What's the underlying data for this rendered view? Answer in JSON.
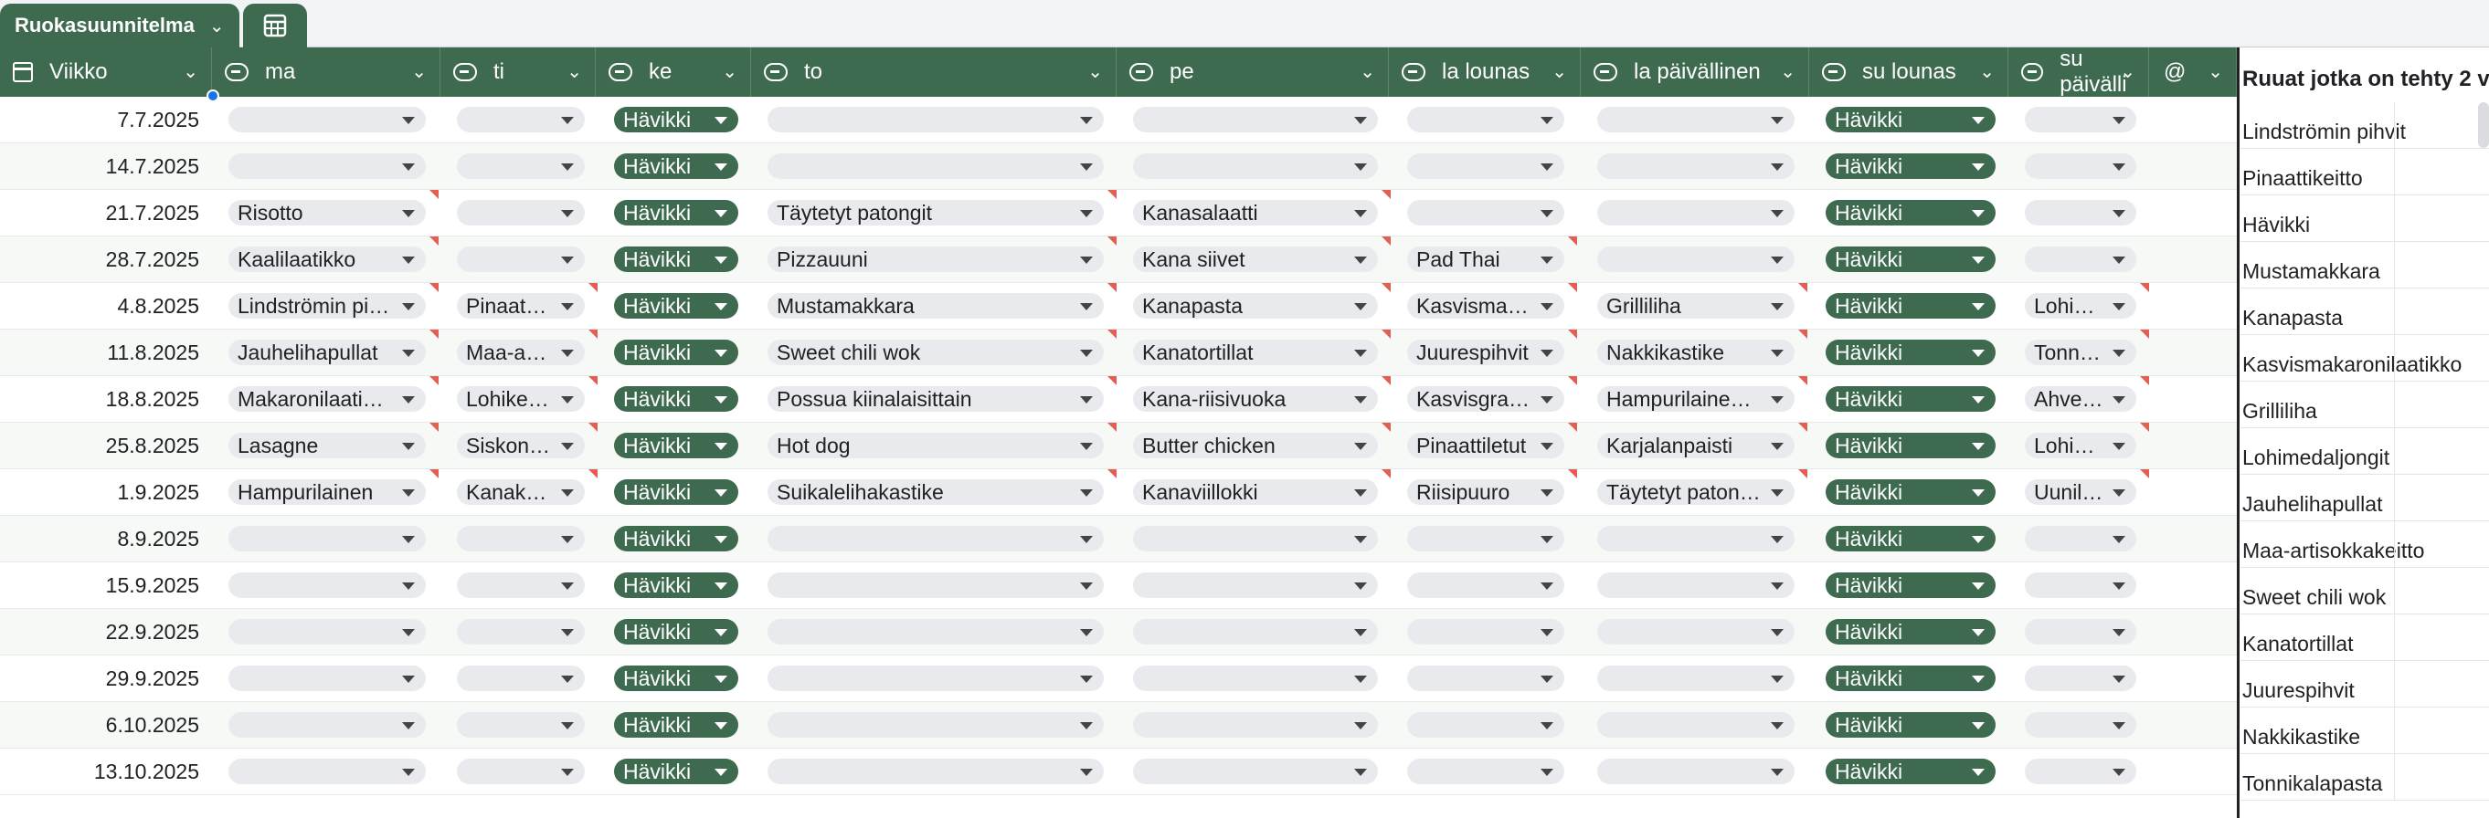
{
  "tabs": {
    "sheet_name": "Ruokasuunnitelma",
    "caret": "⌄",
    "sheet_icon": "table-grid-icon"
  },
  "columns": [
    {
      "key": "viikko",
      "label": "Viikko"
    },
    {
      "key": "ma",
      "label": "ma"
    },
    {
      "key": "ti",
      "label": "ti"
    },
    {
      "key": "ke",
      "label": "ke"
    },
    {
      "key": "to",
      "label": "to"
    },
    {
      "key": "pe",
      "label": "pe"
    },
    {
      "key": "la_lounas",
      "label": "la lounas"
    },
    {
      "key": "la_paivallinen",
      "label": "la päivällinen"
    },
    {
      "key": "su_lounas",
      "label": "su lounas"
    },
    {
      "key": "su_paivallinen",
      "label": "su päivälli"
    },
    {
      "key": "at",
      "label": "@"
    }
  ],
  "rows": [
    {
      "date": "7.7.2025",
      "ma": "",
      "ti": "",
      "ke": "Hävikki",
      "to": "",
      "pe": "",
      "la_lounas": "",
      "la_paivallinen": "",
      "su_lounas": "Hävikki",
      "su_paivallinen": ""
    },
    {
      "date": "14.7.2025",
      "ma": "",
      "ti": "",
      "ke": "Hävikki",
      "to": "",
      "pe": "",
      "la_lounas": "",
      "la_paivallinen": "",
      "su_lounas": "Hävikki",
      "su_paivallinen": ""
    },
    {
      "date": "21.7.2025",
      "ma": "Risotto",
      "ti": "",
      "ke": "Hävikki",
      "to": "Täytetyt patongit",
      "pe": "Kanasalaatti",
      "la_lounas": "",
      "la_paivallinen": "",
      "su_lounas": "Hävikki",
      "su_paivallinen": ""
    },
    {
      "date": "28.7.2025",
      "ma": "Kaalilaatikko",
      "ti": "",
      "ke": "Hävikki",
      "to": "Pizzauuni",
      "pe": "Kana siivet",
      "la_lounas": "Pad Thai",
      "la_paivallinen": "",
      "su_lounas": "Hävikki",
      "su_paivallinen": ""
    },
    {
      "date": "4.8.2025",
      "ma": "Lindströmin pihvit",
      "ti": "Pinaattikeitto",
      "ke": "Hävikki",
      "to": "Mustamakkara",
      "pe": "Kanapasta",
      "la_lounas": "Kasvismakaronilaatikko",
      "la_paivallinen": "Grilliliha",
      "su_lounas": "Hävikki",
      "su_paivallinen": "Lohimedaljongit"
    },
    {
      "date": "11.8.2025",
      "ma": "Jauhelihapullat",
      "ti": "Maa-artisokkakeitto",
      "ke": "Hävikki",
      "to": "Sweet chili wok",
      "pe": "Kanatortillat",
      "la_lounas": "Juurespihvit",
      "la_paivallinen": "Nakkikastike",
      "su_lounas": "Hävikki",
      "su_paivallinen": "Tonnikalapasta"
    },
    {
      "date": "18.8.2025",
      "ma": "Makaronilaatikko",
      "ti": "Lohikeitto",
      "ke": "Hävikki",
      "to": "Possua kiinalaisittain",
      "pe": "Kana-riisivuoka",
      "la_lounas": "Kasvisgratini",
      "la_paivallinen": "Hampurilainen ateria",
      "su_lounas": "Hävikki",
      "su_paivallinen": "Ahvenfilee"
    },
    {
      "date": "25.8.2025",
      "ma": "Lasagne",
      "ti": "Siskonmakkarakeitto",
      "ke": "Hävikki",
      "to": "Hot dog",
      "pe": "Butter chicken",
      "la_lounas": "Pinaattiletut",
      "la_paivallinen": "Karjalanpaisti",
      "su_lounas": "Hävikki",
      "su_paivallinen": "Lohikiusaus"
    },
    {
      "date": "1.9.2025",
      "ma": "Hampurilainen",
      "ti": "Kanakeitto",
      "ke": "Hävikki",
      "to": "Suikalelihakastike",
      "pe": "Kanaviillokki",
      "la_lounas": "Riisipuuro",
      "la_paivallinen": "Täytetyt patongit",
      "su_lounas": "Hävikki",
      "su_paivallinen": "Uunilohi"
    },
    {
      "date": "8.9.2025",
      "ma": "",
      "ti": "",
      "ke": "Hävikki",
      "to": "",
      "pe": "",
      "la_lounas": "",
      "la_paivallinen": "",
      "su_lounas": "Hävikki",
      "su_paivallinen": ""
    },
    {
      "date": "15.9.2025",
      "ma": "",
      "ti": "",
      "ke": "Hävikki",
      "to": "",
      "pe": "",
      "la_lounas": "",
      "la_paivallinen": "",
      "su_lounas": "Hävikki",
      "su_paivallinen": ""
    },
    {
      "date": "22.9.2025",
      "ma": "",
      "ti": "",
      "ke": "Hävikki",
      "to": "",
      "pe": "",
      "la_lounas": "",
      "la_paivallinen": "",
      "su_lounas": "Hävikki",
      "su_paivallinen": ""
    },
    {
      "date": "29.9.2025",
      "ma": "",
      "ti": "",
      "ke": "Hävikki",
      "to": "",
      "pe": "",
      "la_lounas": "",
      "la_paivallinen": "",
      "su_lounas": "Hävikki",
      "su_paivallinen": ""
    },
    {
      "date": "6.10.2025",
      "ma": "",
      "ti": "",
      "ke": "Hävikki",
      "to": "",
      "pe": "",
      "la_lounas": "",
      "la_paivallinen": "",
      "su_lounas": "Hävikki",
      "su_paivallinen": ""
    },
    {
      "date": "13.10.2025",
      "ma": "",
      "ti": "",
      "ke": "Hävikki",
      "to": "",
      "pe": "",
      "la_lounas": "",
      "la_paivallinen": "",
      "su_lounas": "Hävikki",
      "su_paivallinen": ""
    }
  ],
  "side_panel": {
    "header": "Ruuat jotka on tehty 2 v",
    "items": [
      "Lindströmin pihvit",
      "Pinaattikeitto",
      "Hävikki",
      "Mustamakkara",
      "Kanapasta",
      "Kasvismakaronilaatikko",
      "Grilliliha",
      "Lohimedaljongit",
      "Jauhelihapullat",
      "Maa-artisokkakeitto",
      "Sweet chili wok",
      "Kanatortillat",
      "Juurespihvit",
      "Nakkikastike",
      "Tonnikalapasta"
    ]
  },
  "colors": {
    "header_green": "#3e6b4f",
    "chip_grey": "#e8eaed",
    "note_red": "#e06055"
  }
}
